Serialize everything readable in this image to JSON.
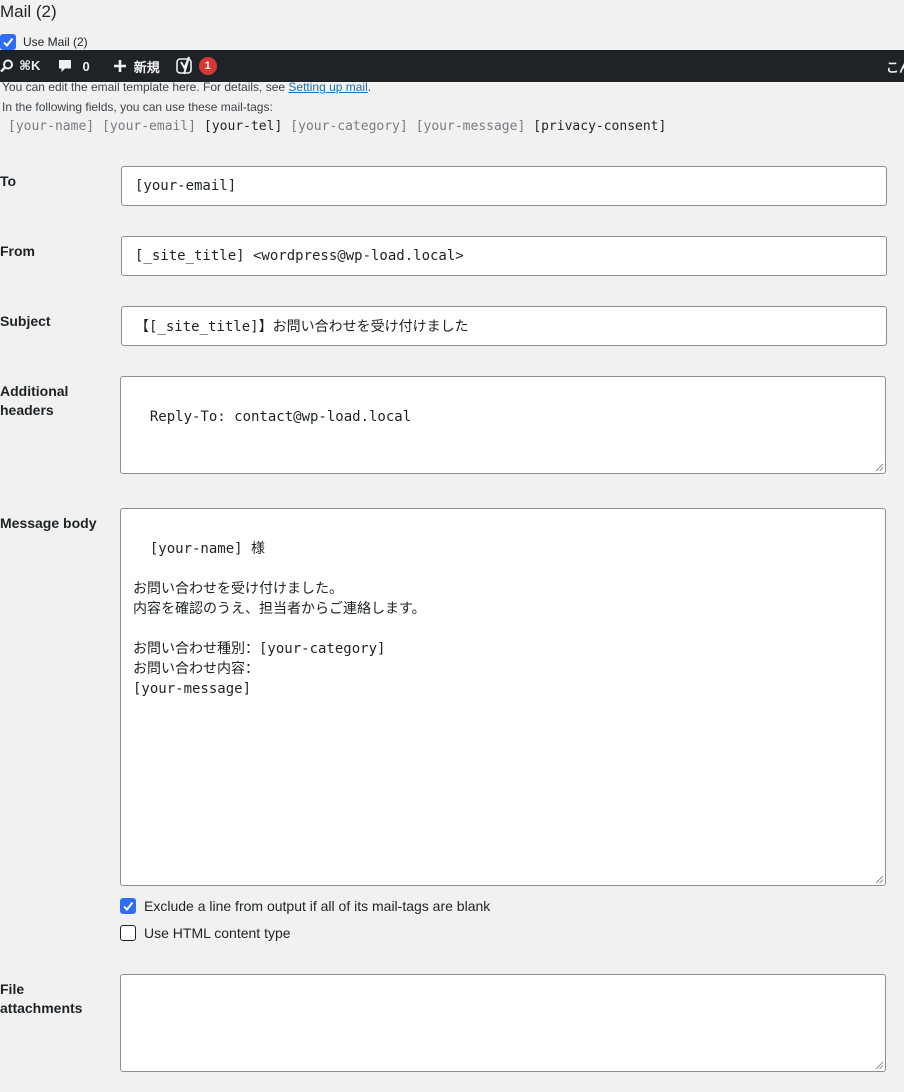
{
  "section_title": "Mail (2)",
  "use_mail": {
    "label": "Use Mail (2)",
    "checked": true
  },
  "adminbar": {
    "shortcut": "⌘K",
    "comments_count": "0",
    "new_label": "新規",
    "yoast_badge": "1",
    "greeting": "こん"
  },
  "intro": {
    "text": "You can edit the email template here. For details, see ",
    "link": "Setting up mail",
    "after": ".",
    "line2": "In the following fields, you can use these mail-tags:"
  },
  "mail_tags": [
    {
      "tag": "[your-name]",
      "used": false
    },
    {
      "tag": "[your-email]",
      "used": false
    },
    {
      "tag": "[your-tel]",
      "used": true
    },
    {
      "tag": "[your-category]",
      "used": false
    },
    {
      "tag": "[your-message]",
      "used": false
    },
    {
      "tag": "[privacy-consent]",
      "used": true
    }
  ],
  "fields": {
    "to": {
      "label": "To",
      "value": "[your-email]"
    },
    "from": {
      "label": "From",
      "value": "[_site_title] <wordpress@wp-load.local>"
    },
    "subject": {
      "label": "Subject",
      "value": "【[_site_title]】お問い合わせを受け付けました"
    },
    "additional_headers": {
      "label": "Additional headers",
      "value": "Reply-To: contact@wp-load.local"
    },
    "message_body": {
      "label": "Message body",
      "value": "[your-name] 様\n\nお問い合わせを受け付けました。\n内容を確認のうえ、担当者からご連絡します。\n\nお問い合わせ種別：[your-category]\nお問い合わせ内容：\n[your-message]"
    },
    "file_attachments": {
      "label": "File attachments",
      "value": ""
    }
  },
  "options": {
    "exclude_blank": {
      "label": "Exclude a line from output if all of its mail-tags are blank",
      "checked": true
    },
    "html_content": {
      "label": "Use HTML content type",
      "checked": false
    }
  },
  "colors": {
    "accent": "#2f6df6",
    "adminbar": "#1d2327",
    "badge": "#d63638",
    "link": "#2271b1"
  }
}
